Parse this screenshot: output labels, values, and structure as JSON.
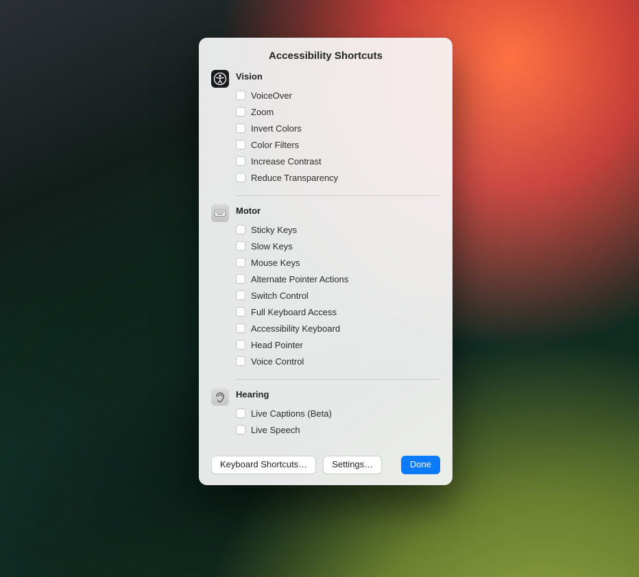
{
  "title": "Accessibility Shortcuts",
  "sections": [
    {
      "icon": "accessibility-icon",
      "heading": "Vision",
      "items": [
        {
          "label": "VoiceOver"
        },
        {
          "label": "Zoom"
        },
        {
          "label": "Invert Colors"
        },
        {
          "label": "Color Filters"
        },
        {
          "label": "Increase Contrast"
        },
        {
          "label": "Reduce Transparency"
        }
      ]
    },
    {
      "icon": "keyboard-icon",
      "heading": "Motor",
      "items": [
        {
          "label": "Sticky Keys"
        },
        {
          "label": "Slow Keys"
        },
        {
          "label": "Mouse Keys"
        },
        {
          "label": "Alternate Pointer Actions"
        },
        {
          "label": "Switch Control"
        },
        {
          "label": "Full Keyboard Access"
        },
        {
          "label": "Accessibility Keyboard"
        },
        {
          "label": "Head Pointer"
        },
        {
          "label": "Voice Control"
        }
      ]
    },
    {
      "icon": "ear-icon",
      "heading": "Hearing",
      "items": [
        {
          "label": "Live Captions (Beta)"
        },
        {
          "label": "Live Speech"
        }
      ]
    }
  ],
  "buttons": {
    "keyboard_shortcuts": "Keyboard Shortcuts…",
    "settings": "Settings…",
    "done": "Done"
  }
}
